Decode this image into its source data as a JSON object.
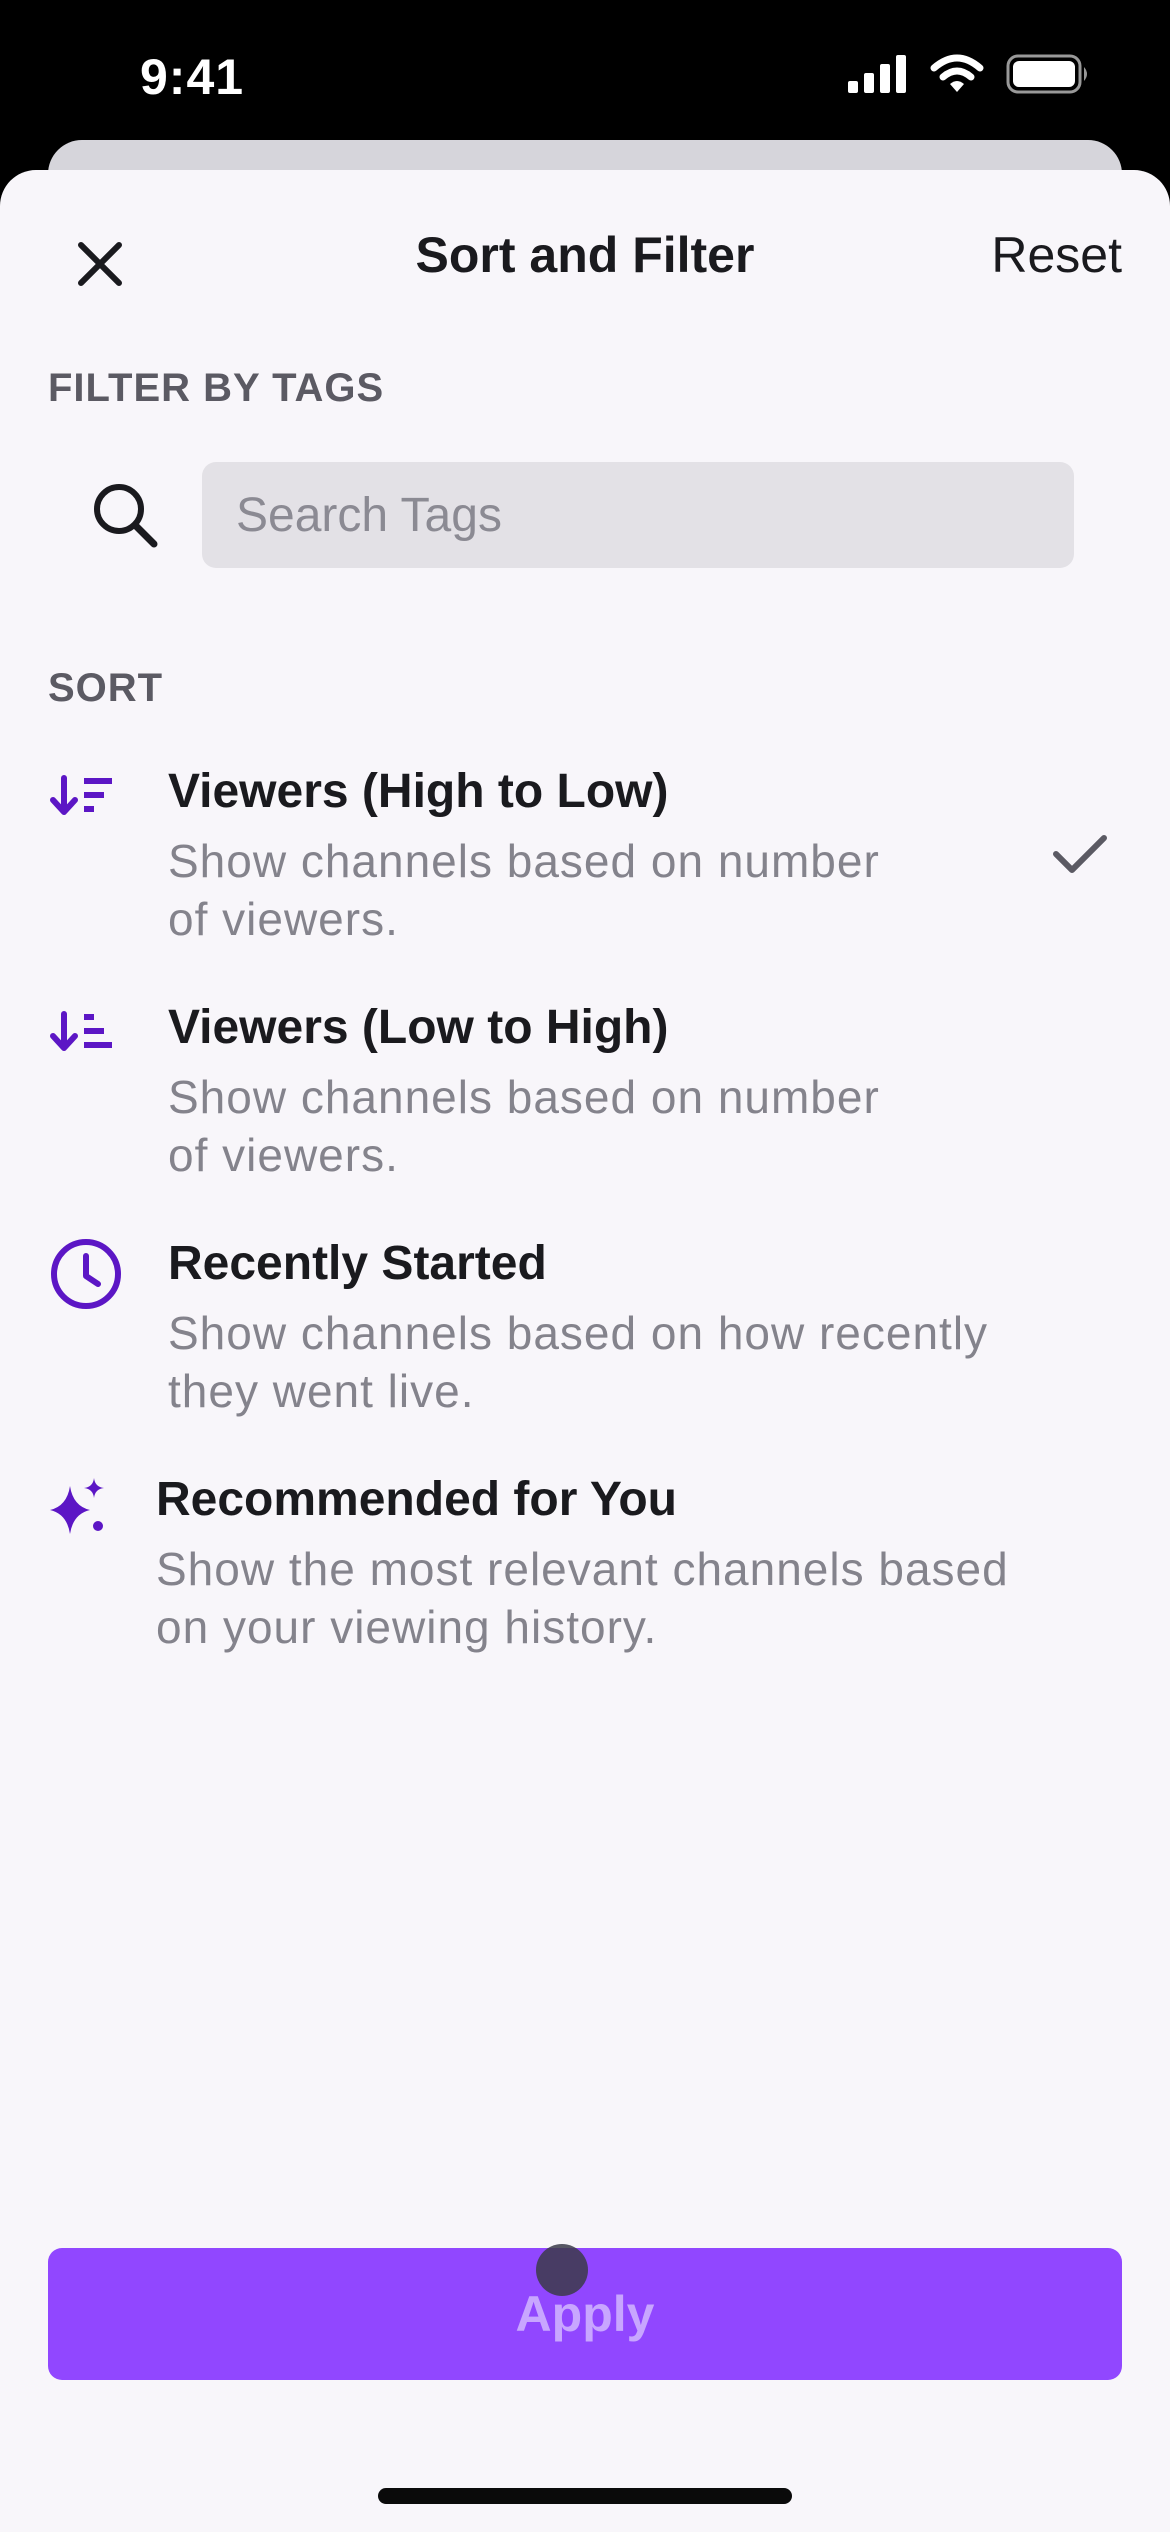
{
  "status_bar": {
    "time": "9:41"
  },
  "header": {
    "title": "Sort and Filter",
    "reset_label": "Reset"
  },
  "filter": {
    "label": "FILTER BY TAGS",
    "search_placeholder": "Search Tags",
    "search_value": ""
  },
  "sort": {
    "label": "SORT",
    "options": [
      {
        "title": "Viewers (High to Low)",
        "desc_line1": "Show channels based on number",
        "desc_line2": "of viewers.",
        "icon": "sort-descending-icon",
        "selected": true
      },
      {
        "title": "Viewers (Low to High)",
        "desc_line1": "Show channels based on number",
        "desc_line2": "of viewers.",
        "icon": "sort-ascending-icon",
        "selected": false
      },
      {
        "title": "Recently Started",
        "desc_line1": "Show channels based on how recently",
        "desc_line2": "they went live.",
        "icon": "clock-icon",
        "selected": false
      },
      {
        "title": "Recommended for You",
        "desc_line1": "Show the most relevant channels based",
        "desc_line2": "on your viewing history.",
        "icon": "sparkle-icon",
        "selected": false
      }
    ]
  },
  "apply_label": "Apply",
  "colors": {
    "accent": "#9147ff",
    "icon_purple": "#5c16c5",
    "sheet_bg": "#f8f6fa"
  }
}
